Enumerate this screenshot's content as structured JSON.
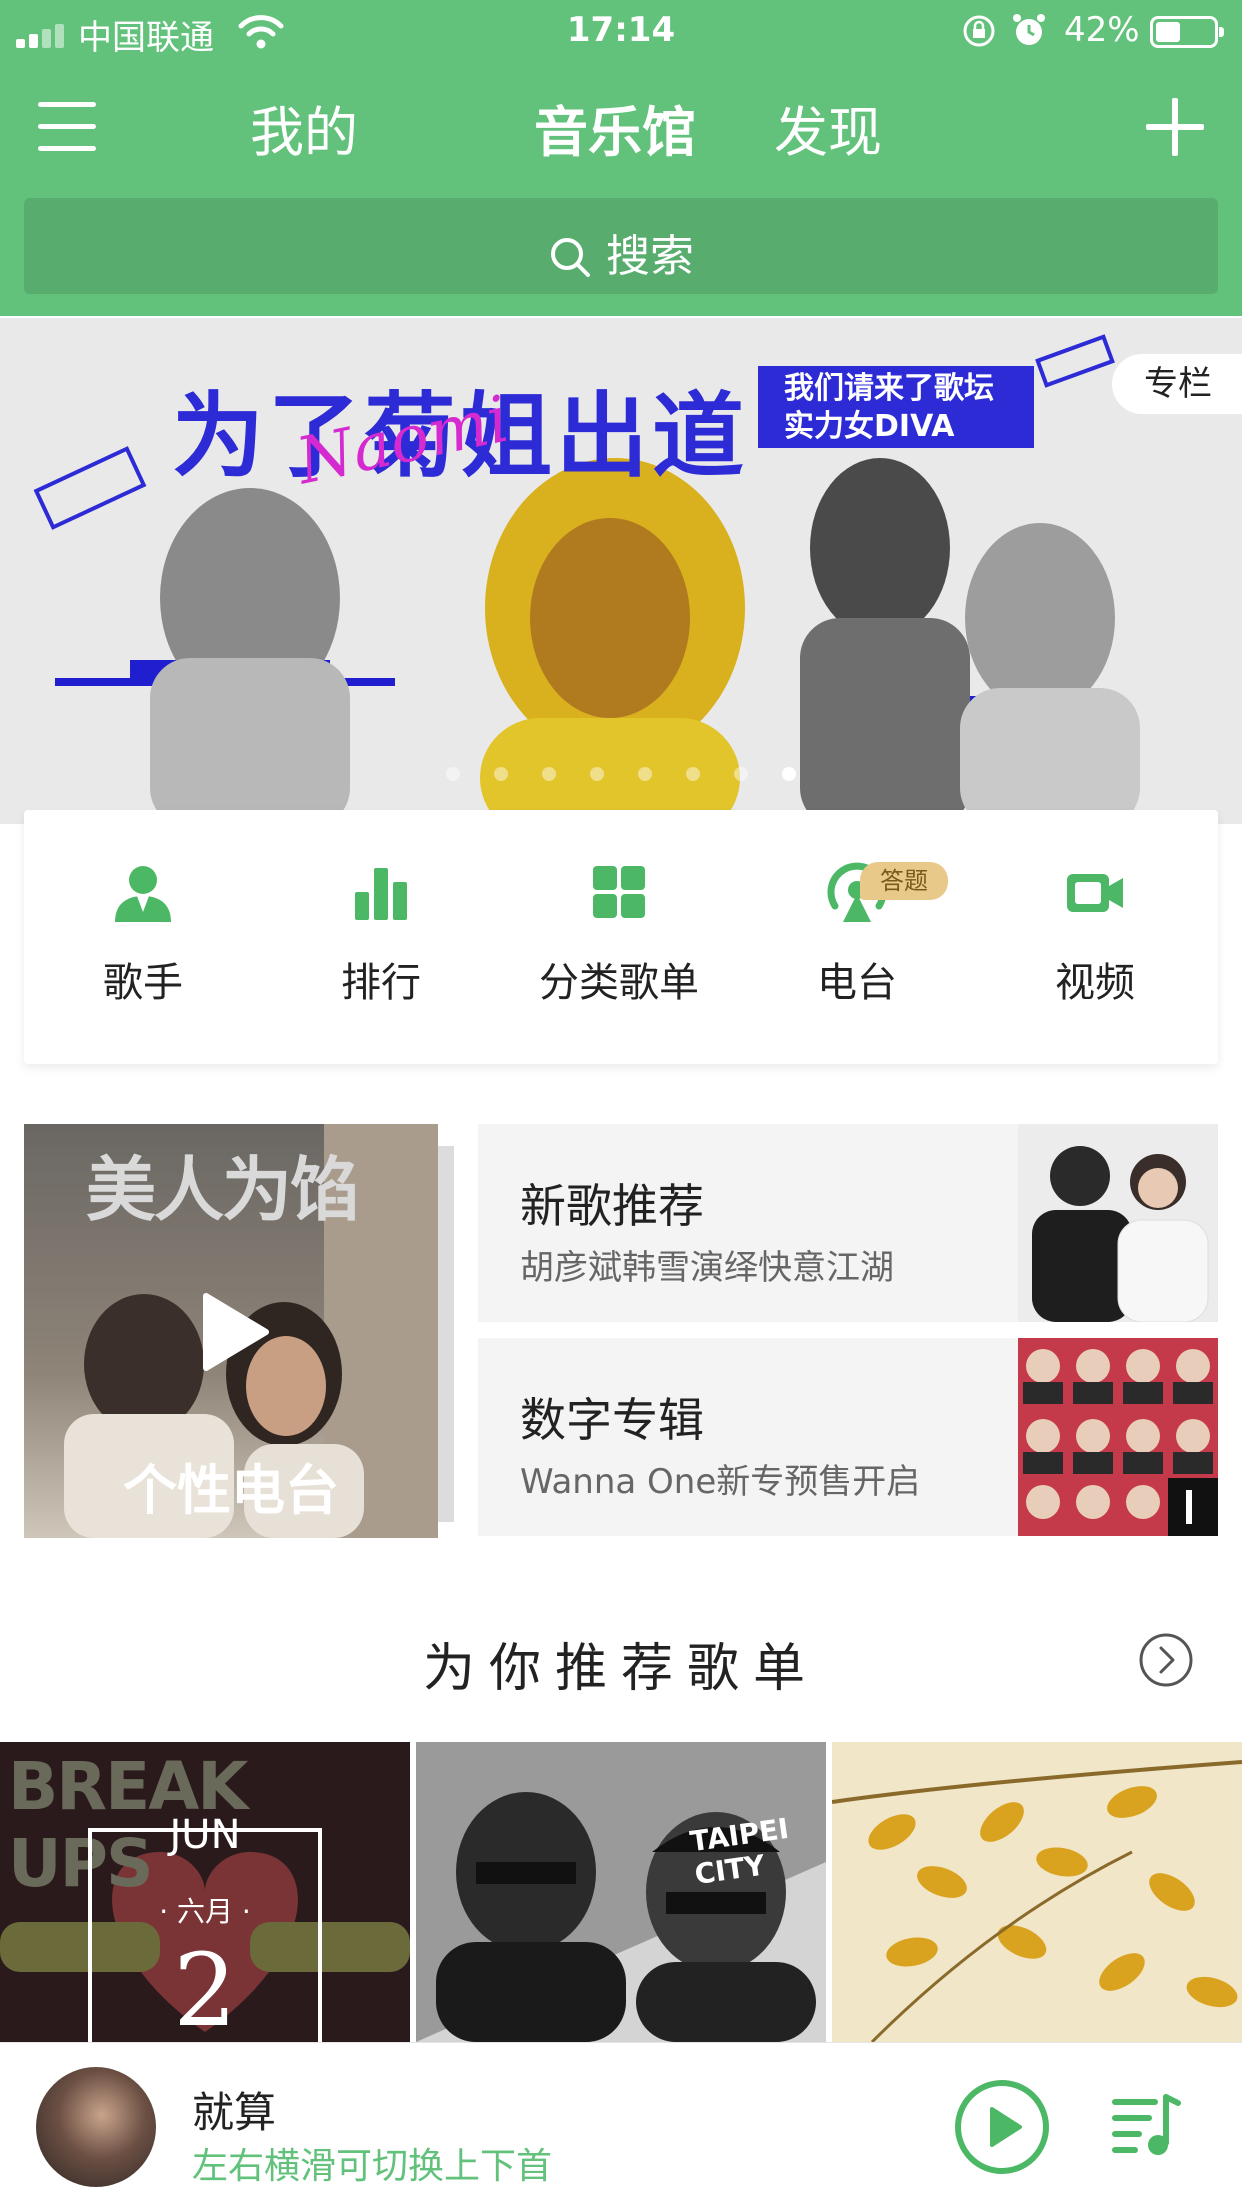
{
  "status_bar": {
    "carrier": "中国联通",
    "time": "17:14",
    "battery": "42%",
    "battery_level": 0.42
  },
  "nav": {
    "tabs": [
      {
        "label": "我的",
        "active": false
      },
      {
        "label": "音乐馆",
        "active": true
      },
      {
        "label": "发现",
        "active": false
      }
    ]
  },
  "search": {
    "label": "搜索"
  },
  "banner": {
    "headline": "为了菊姐出道",
    "subtitle_line1": "我们请来了歌坛",
    "subtitle_line2": "实力女DIVA",
    "script_text": "Naomi",
    "tag": "专栏",
    "dot_count": 8,
    "active_dot": 7
  },
  "categories": [
    {
      "label": "歌手",
      "icon": "singer-icon"
    },
    {
      "label": "排行",
      "icon": "chart-bars-icon"
    },
    {
      "label": "分类歌单",
      "icon": "grid-icon"
    },
    {
      "label": "电台",
      "icon": "radio-icon",
      "badge": "答题"
    },
    {
      "label": "视频",
      "icon": "video-camera-icon"
    }
  ],
  "featured": {
    "radio": {
      "label": "个性电台",
      "art_title": "美人为馅"
    },
    "items": [
      {
        "title": "新歌推荐",
        "subtitle": "胡彦斌韩雪演绎快意江湖"
      },
      {
        "title": "数字专辑",
        "subtitle": "Wanna One新专预售开启"
      }
    ]
  },
  "recommend": {
    "title": "为你推荐歌单",
    "tiles": [
      {
        "art_text": "BREAK UPS",
        "month": "JUN",
        "month_cn": "· 六月 ·",
        "day": "2"
      },
      {
        "art_text": "TAIPEI CITY"
      },
      {
        "art_text": ""
      }
    ]
  },
  "player": {
    "song": "就算",
    "hint": "左右横滑可切换上下首"
  },
  "colors": {
    "brand_green": "#62c17a",
    "search_green": "#58ad6e",
    "banner_blue": "#2d2bd6"
  }
}
